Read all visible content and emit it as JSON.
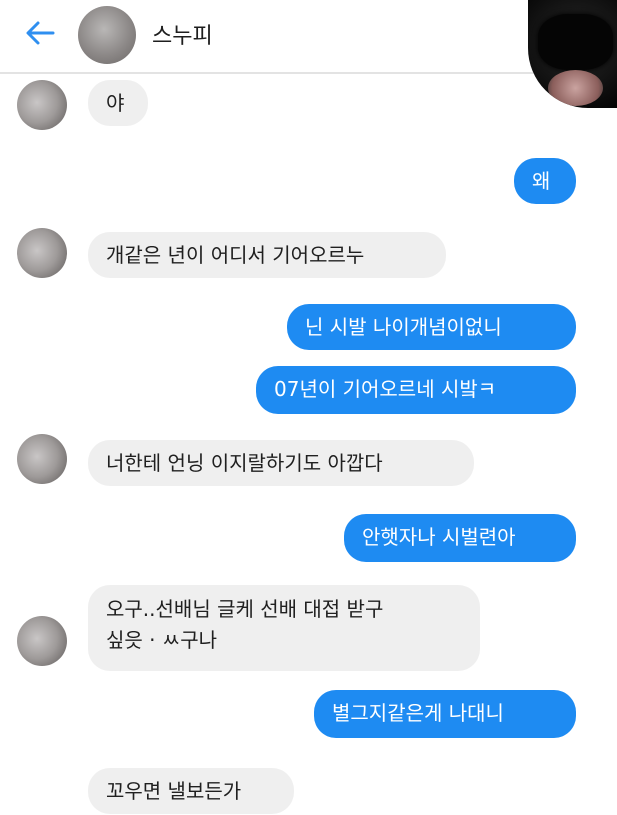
{
  "header": {
    "title": "스누피"
  },
  "messages": [
    {
      "side": "received",
      "text": "야"
    },
    {
      "side": "sent",
      "text": "왜"
    },
    {
      "side": "received",
      "text": "개같은 년이 어디서 기어오르누"
    },
    {
      "side": "sent",
      "text": "닌 시발 나이개념이없니"
    },
    {
      "side": "sent",
      "text": "07년이 기어오르네 시밬ㅋ"
    },
    {
      "side": "received",
      "text": "너한테 언닝 이지랄하기도 아깝다"
    },
    {
      "side": "sent",
      "text": "안햇자나 시벌련아"
    },
    {
      "side": "received",
      "lines": [
        "오구..선배님  글케 선배 대접 받구",
        "싶읏 · ㅆ구나"
      ]
    },
    {
      "side": "sent",
      "text": "별그지같은게 나대니"
    },
    {
      "side": "received",
      "text": "꼬우면 낼보든가"
    }
  ],
  "icons": {
    "back": "back-arrow-icon"
  },
  "colors": {
    "sent_bubble": "#1e8bf2",
    "received_bubble": "#efefef",
    "accent": "#2f8ff0"
  }
}
